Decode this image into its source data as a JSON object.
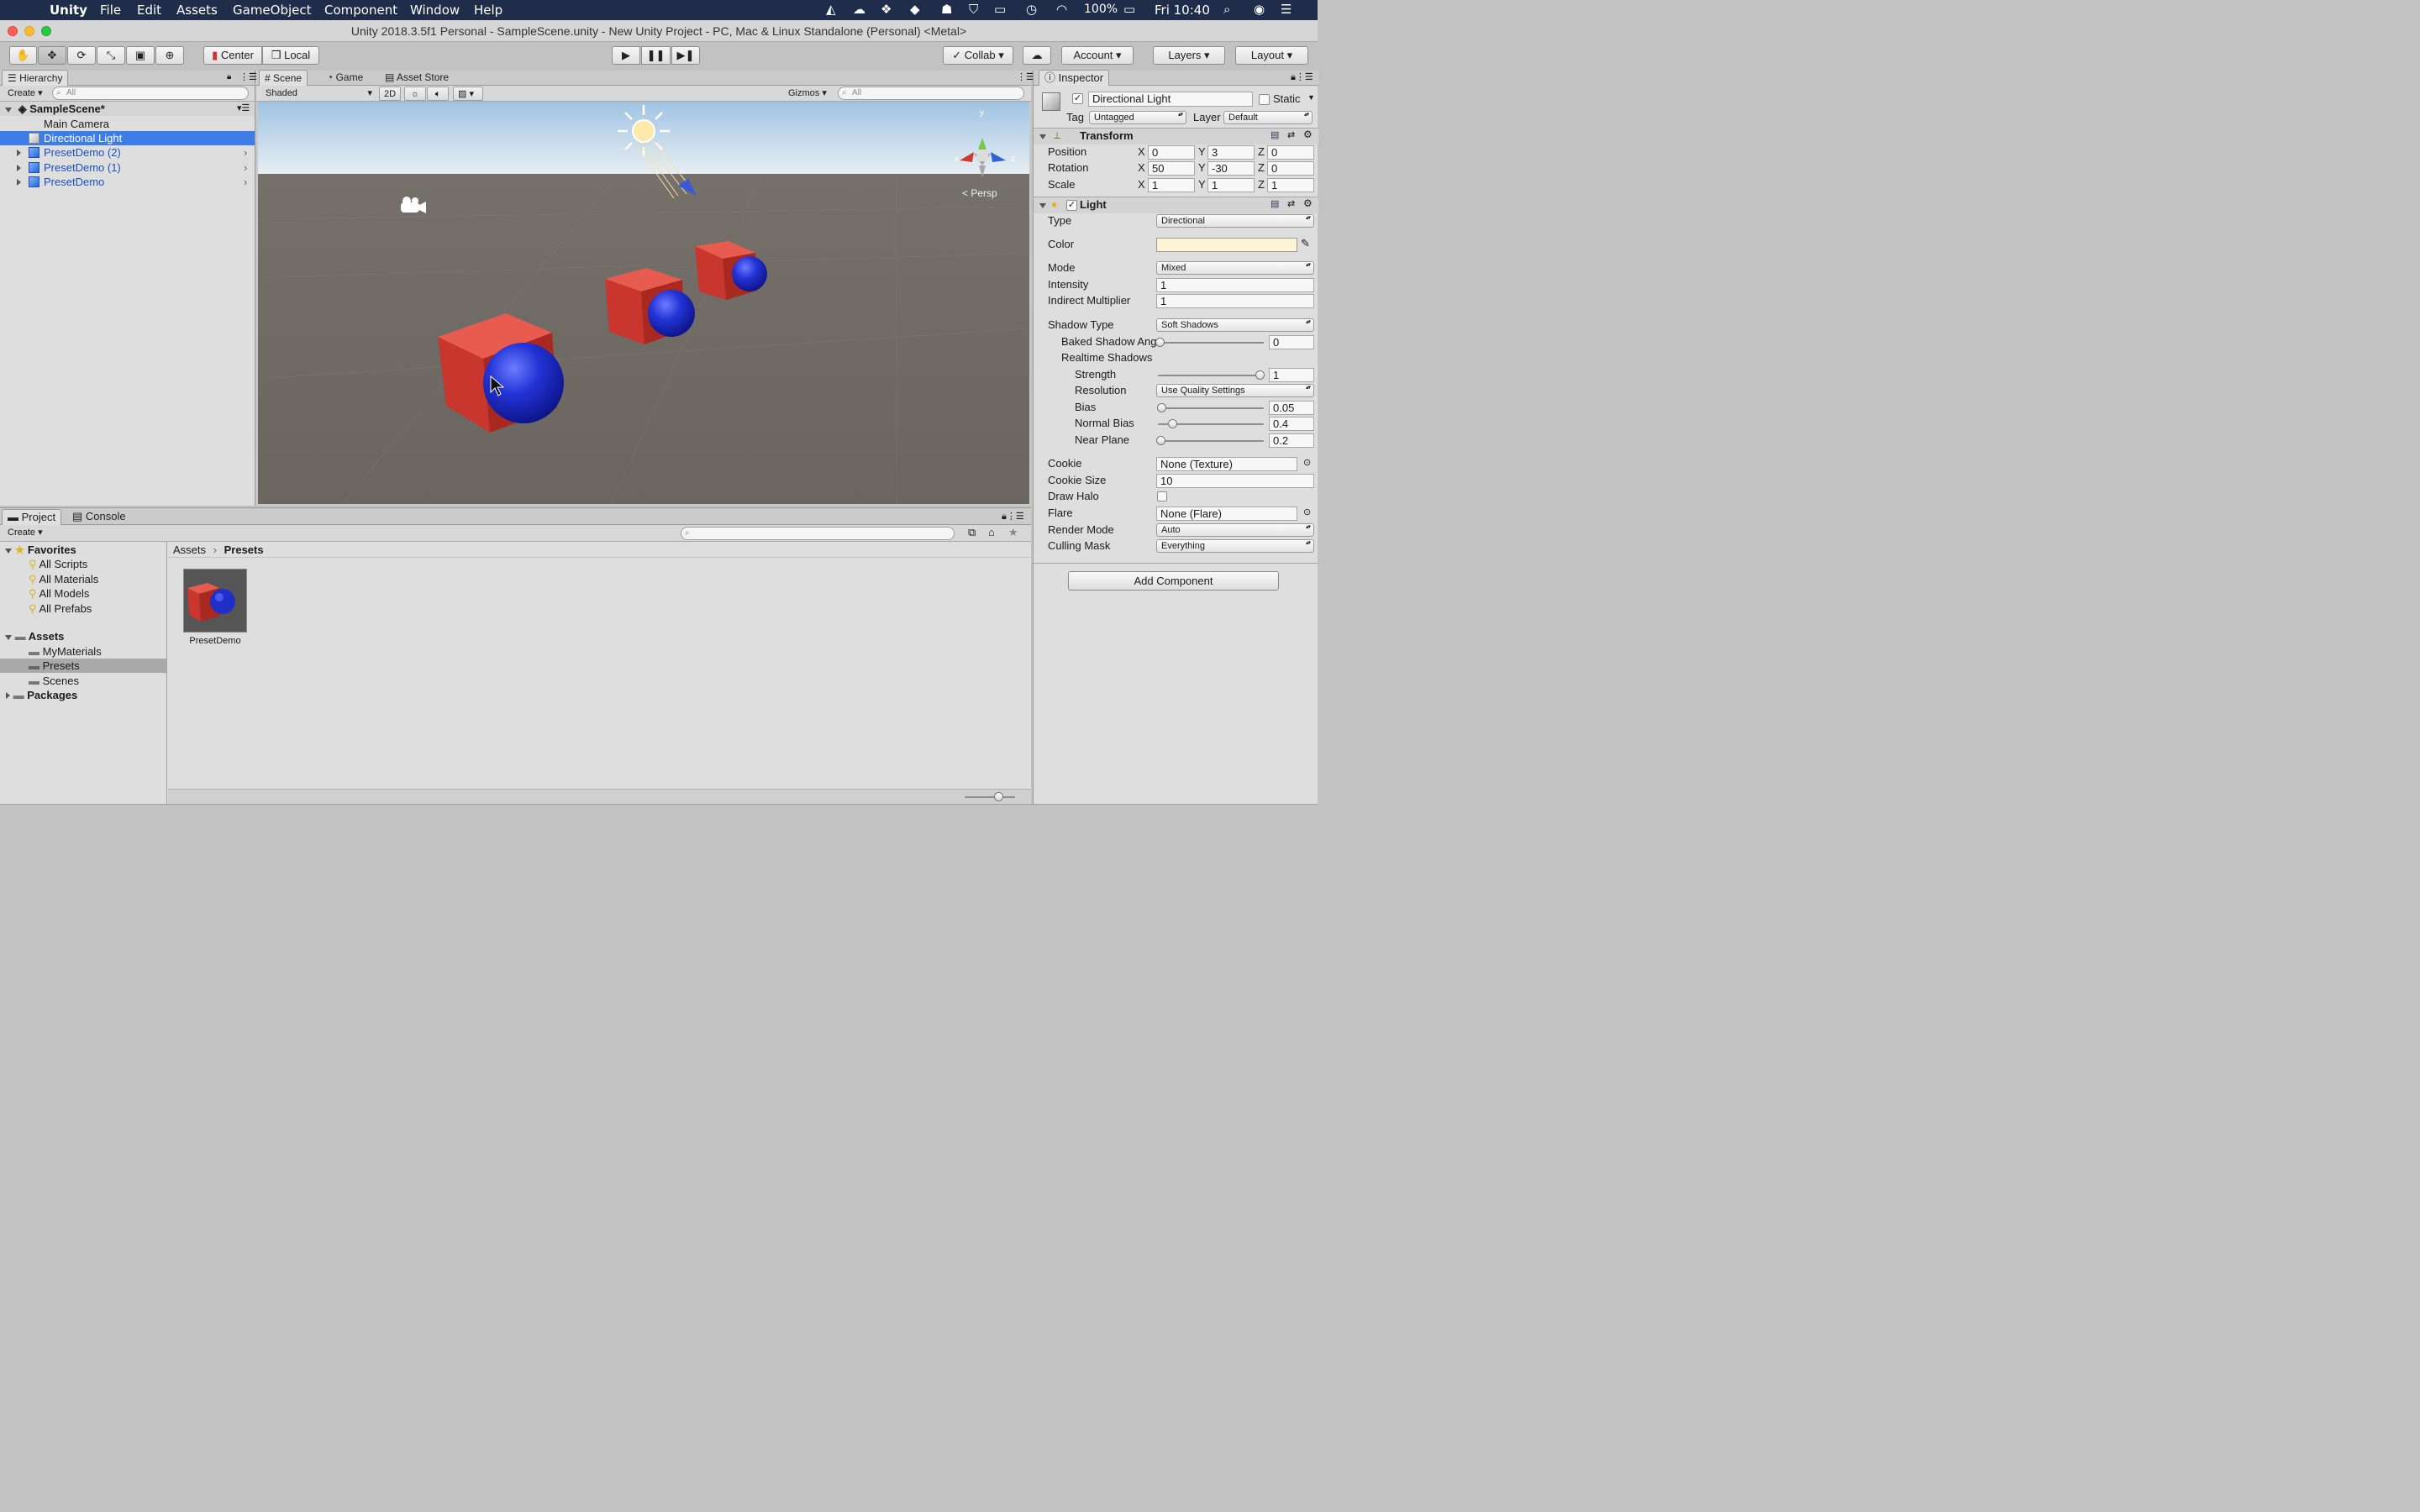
{
  "menubar": {
    "app": "Unity",
    "items": [
      "File",
      "Edit",
      "Assets",
      "GameObject",
      "Component",
      "Window",
      "Help"
    ],
    "battery": "100%",
    "clock": "Fri 10:40"
  },
  "window": {
    "title": "Unity 2018.3.5f1 Personal - SampleScene.unity - New Unity Project - PC, Mac & Linux Standalone (Personal) <Metal>"
  },
  "toolbar": {
    "center_label": "Center",
    "local_label": "Local",
    "collab_label": "Collab",
    "account_label": "Account",
    "layers_label": "Layers",
    "layout_label": "Layout"
  },
  "hierarchy": {
    "tab": "Hierarchy",
    "create": "Create",
    "search_placeholder": "All",
    "scene": "SampleScene*",
    "items": [
      {
        "label": "Main Camera"
      },
      {
        "label": "Directional Light"
      },
      {
        "label": "PresetDemo (2)"
      },
      {
        "label": "PresetDemo (1)"
      },
      {
        "label": "PresetDemo"
      }
    ]
  },
  "scene_view": {
    "tabs": [
      "Scene",
      "Game",
      "Asset Store"
    ],
    "shading": "Shaded",
    "mode_2d": "2D",
    "gizmos": "Gizmos",
    "search_placeholder": "All",
    "persp": "Persp",
    "axis_x": "x",
    "axis_y": "y",
    "axis_z": "z"
  },
  "project": {
    "tabs": [
      "Project",
      "Console"
    ],
    "create": "Create",
    "favorites_header": "Favorites",
    "favorites": [
      "All Scripts",
      "All Materials",
      "All Models",
      "All Prefabs"
    ],
    "assets_header": "Assets",
    "asset_folders": [
      "MyMaterials",
      "Presets",
      "Scenes"
    ],
    "packages": "Packages",
    "breadcrumb_root": "Assets",
    "breadcrumb_current": "Presets",
    "files": [
      {
        "name": "PresetDemo"
      }
    ]
  },
  "inspector": {
    "tab": "Inspector",
    "object_name": "Directional Light",
    "static_label": "Static",
    "tag_label": "Tag",
    "tag_value": "Untagged",
    "layer_label": "Layer",
    "layer_value": "Default",
    "transform": {
      "title": "Transform",
      "position": {
        "label": "Position",
        "x": "0",
        "y": "3",
        "z": "0"
      },
      "rotation": {
        "label": "Rotation",
        "x": "50",
        "y": "-30",
        "z": "0"
      },
      "scale": {
        "label": "Scale",
        "x": "1",
        "y": "1",
        "z": "1"
      }
    },
    "light": {
      "title": "Light",
      "type_label": "Type",
      "type_value": "Directional",
      "color_label": "Color",
      "color_value": "#FFF4D6",
      "mode_label": "Mode",
      "mode_value": "Mixed",
      "intensity_label": "Intensity",
      "intensity_value": "1",
      "indirect_label": "Indirect Multiplier",
      "indirect_value": "1",
      "shadow_type_label": "Shadow Type",
      "shadow_type_value": "Soft Shadows",
      "baked_angle_label": "Baked Shadow Ang",
      "baked_angle_value": "0",
      "realtime_label": "Realtime Shadows",
      "strength_label": "Strength",
      "strength_value": "1",
      "resolution_label": "Resolution",
      "resolution_value": "Use Quality Settings",
      "bias_label": "Bias",
      "bias_value": "0.05",
      "normal_bias_label": "Normal Bias",
      "normal_bias_value": "0.4",
      "near_plane_label": "Near Plane",
      "near_plane_value": "0.2",
      "cookie_label": "Cookie",
      "cookie_value": "None (Texture)",
      "cookie_size_label": "Cookie Size",
      "cookie_size_value": "10",
      "draw_halo_label": "Draw Halo",
      "flare_label": "Flare",
      "flare_value": "None (Flare)",
      "render_mode_label": "Render Mode",
      "render_mode_value": "Auto",
      "culling_label": "Culling Mask",
      "culling_value": "Everything"
    },
    "add_component": "Add Component"
  },
  "colors": {
    "selection": "#3e7de8",
    "cube_red": "#d63a32",
    "sphere_blue": "#1f2fc8",
    "sky": "#b9d4ea",
    "ground": "#6b655f"
  }
}
